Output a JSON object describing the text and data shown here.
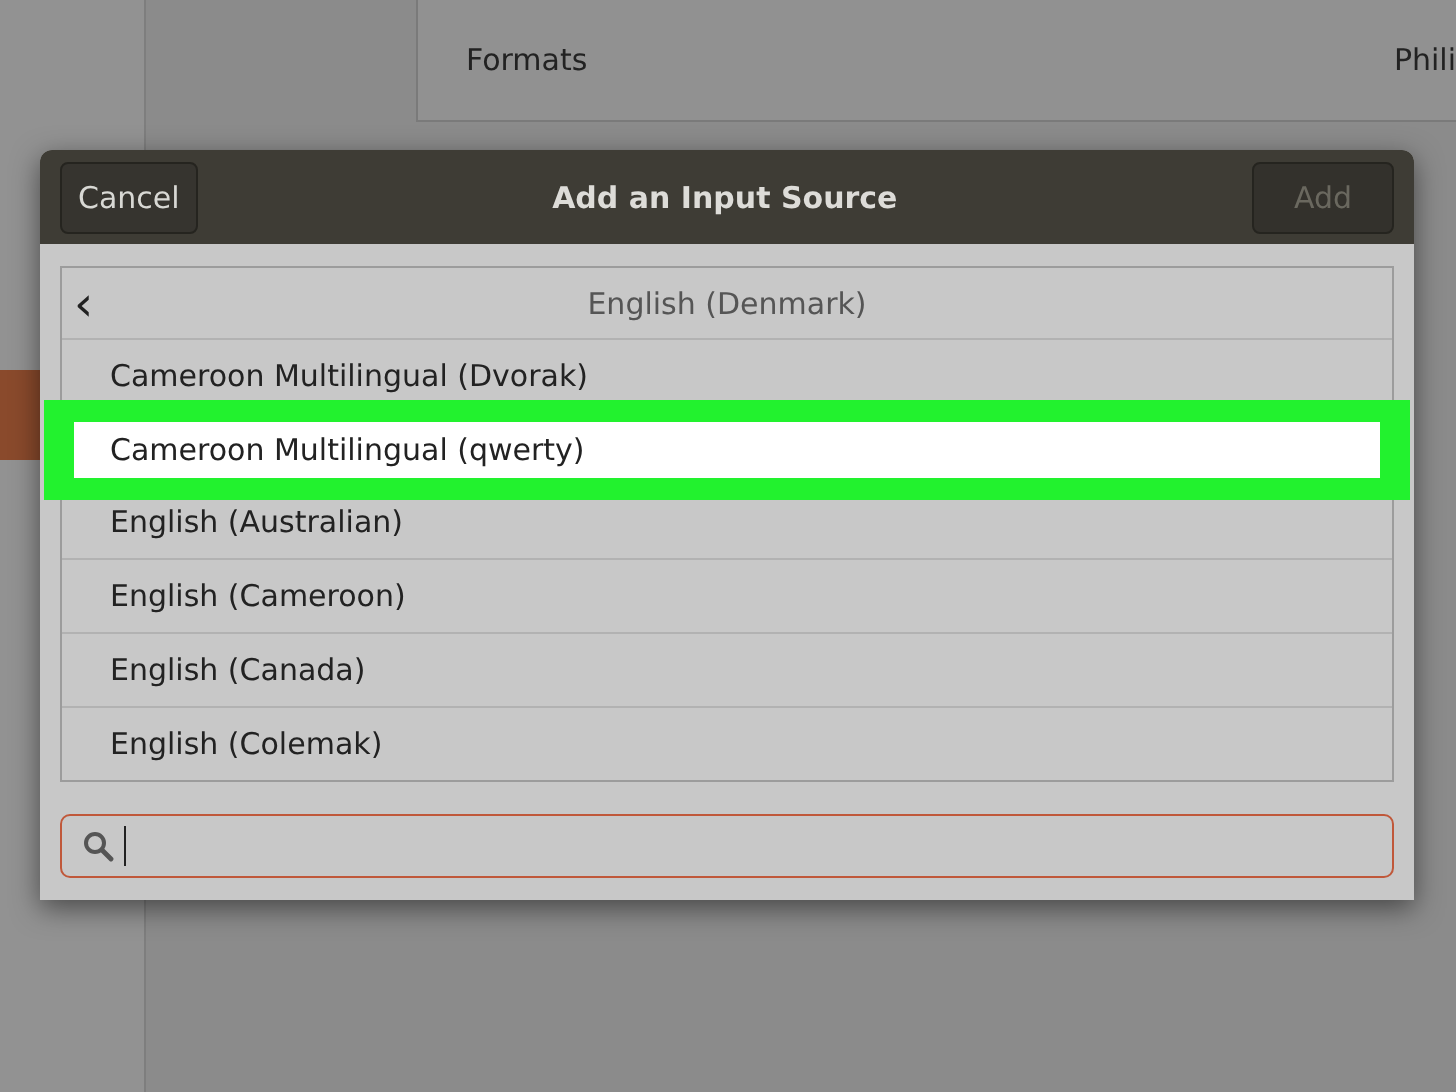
{
  "background_panel": {
    "label": "Formats",
    "value": "Phili"
  },
  "dialog": {
    "title": "Add an Input Source",
    "cancel_button": "Cancel",
    "add_button": {
      "label": "Add",
      "disabled": true
    },
    "back_icon": "‹",
    "category": "English (Denmark)",
    "items": [
      {
        "label": "Cameroon Multilingual (Dvorak)",
        "selected": false
      },
      {
        "label": "Cameroon Multilingual (qwerty)",
        "selected": true
      },
      {
        "label": "English (Australian)",
        "selected": false
      },
      {
        "label": "English (Cameroon)",
        "selected": false
      },
      {
        "label": "English (Canada)",
        "selected": false
      },
      {
        "label": "English (Colemak)",
        "selected": false
      }
    ],
    "search": {
      "focused": true
    }
  }
}
